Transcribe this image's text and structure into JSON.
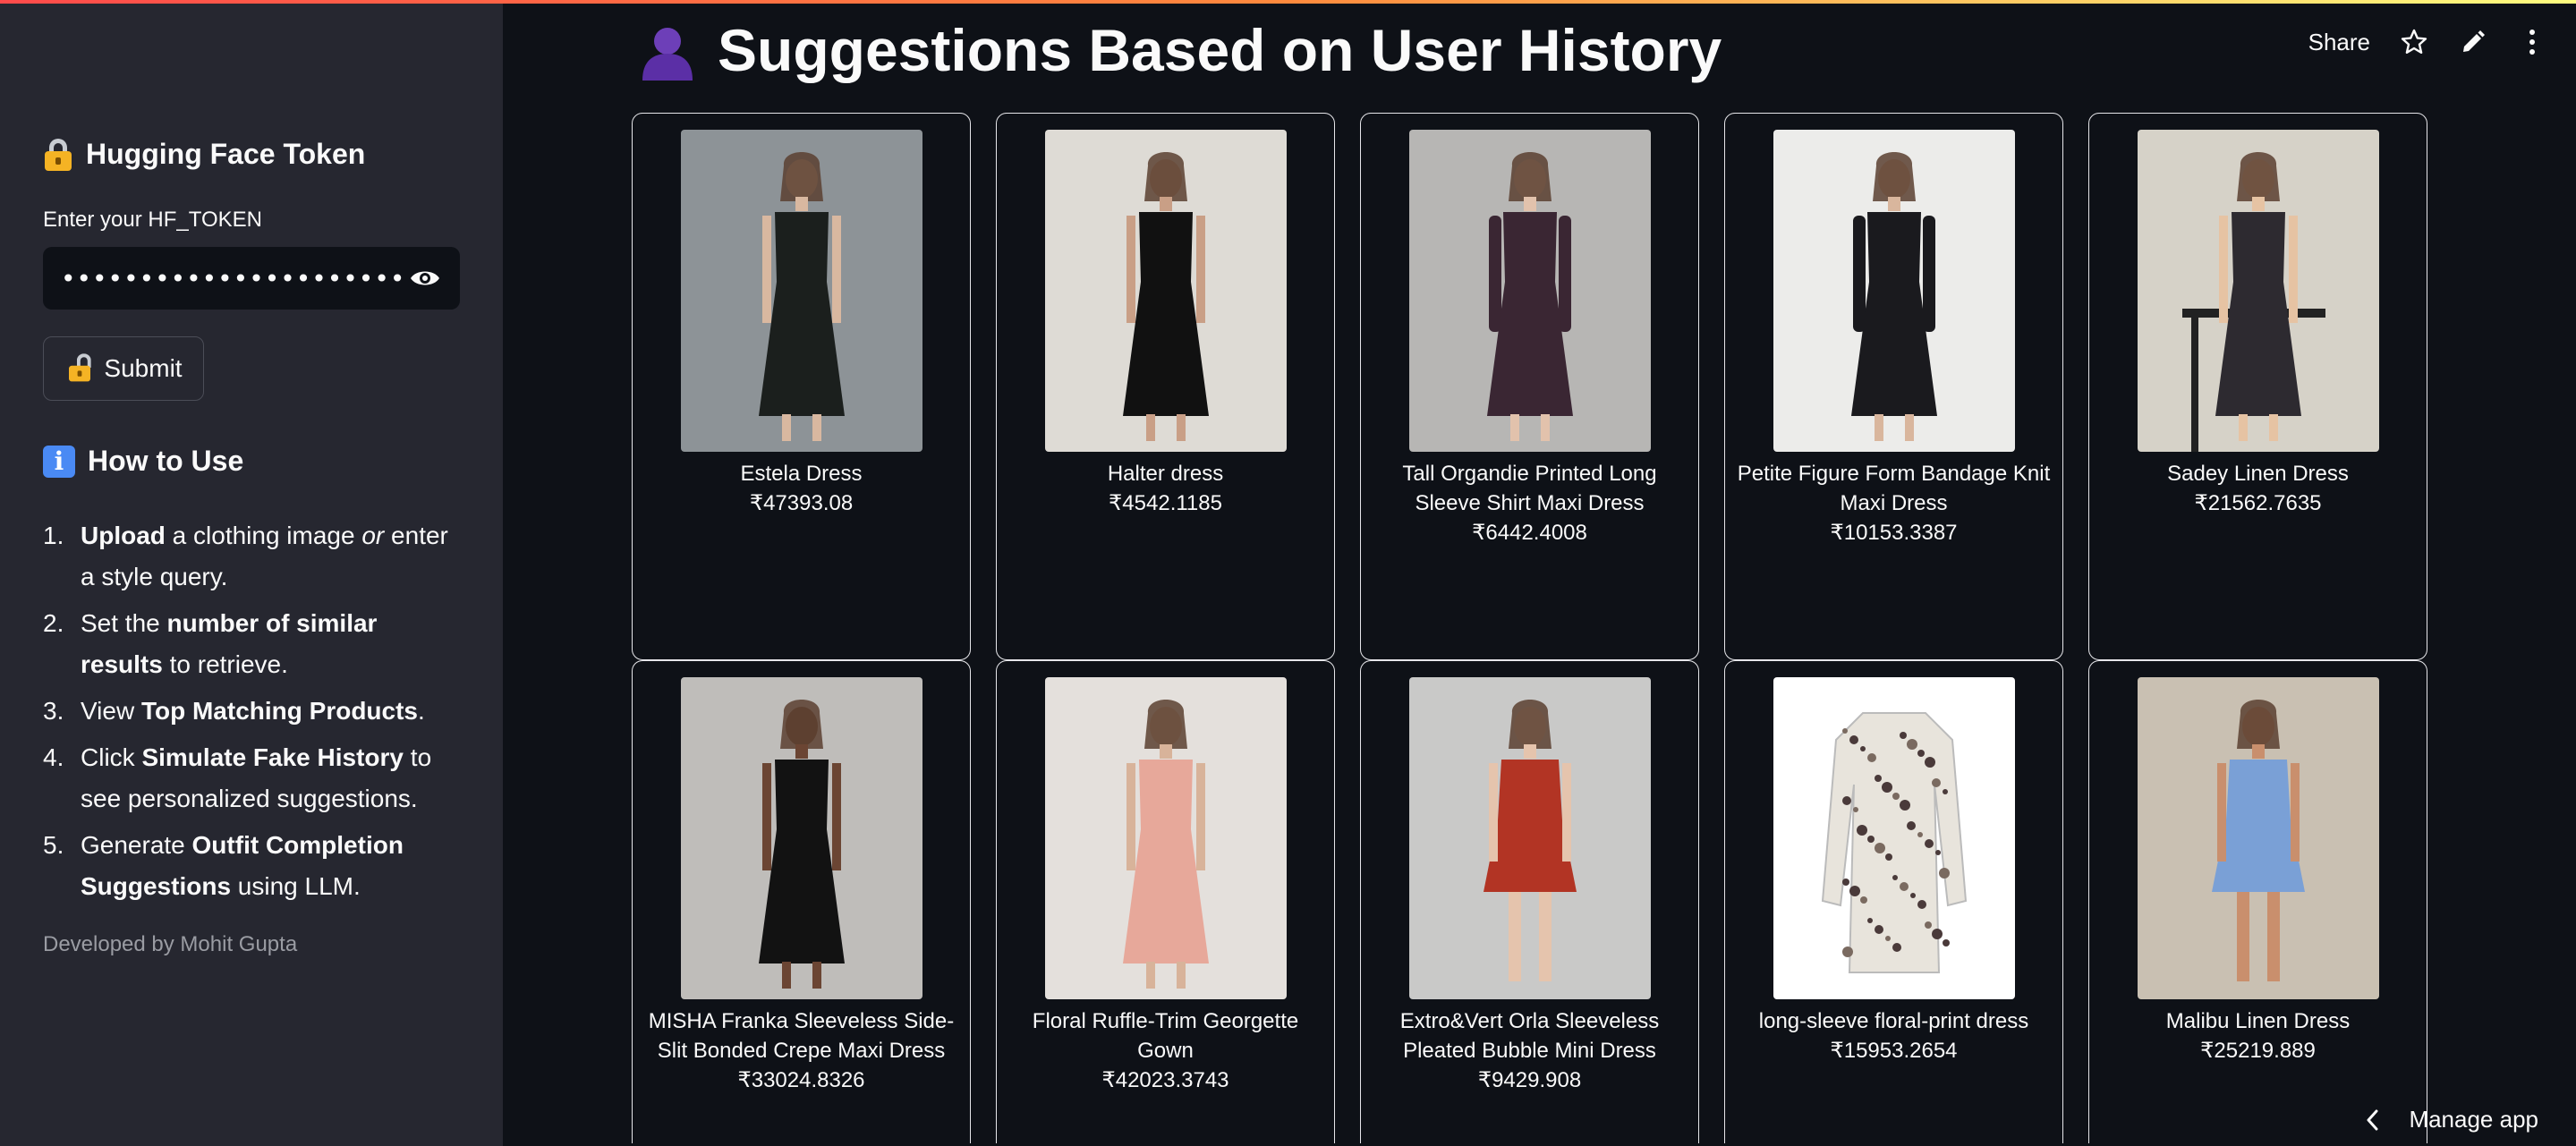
{
  "sidebar": {
    "token_heading": "Hugging Face Token",
    "token_label": "Enter your HF_TOKEN",
    "token_value": "••••••••••••••••••••••••••••••••••••••",
    "submit_label": "Submit",
    "howto_heading": "How to Use",
    "steps": [
      {
        "num": "1.",
        "parts": [
          {
            "b": "Upload"
          },
          {
            "t": " a clothing image "
          },
          {
            "i": "or"
          },
          {
            "t": " enter a style query."
          }
        ]
      },
      {
        "num": "2.",
        "parts": [
          {
            "t": "Set the "
          },
          {
            "b": "number of similar results"
          },
          {
            "t": " to retrieve."
          }
        ]
      },
      {
        "num": "3.",
        "parts": [
          {
            "t": "View "
          },
          {
            "b": "Top Matching Products"
          },
          {
            "t": "."
          }
        ]
      },
      {
        "num": "4.",
        "parts": [
          {
            "t": "Click "
          },
          {
            "b": "Simulate Fake History"
          },
          {
            "t": " to see personalized suggestions."
          }
        ]
      },
      {
        "num": "5.",
        "parts": [
          {
            "t": "Generate "
          },
          {
            "b": "Outfit Completion Suggestions"
          },
          {
            "t": " using LLM."
          }
        ]
      }
    ],
    "credit": "Developed by Mohit Gupta"
  },
  "header": {
    "title": "Suggestions Based on User History",
    "share_label": "Share"
  },
  "products": [
    {
      "name": "Estela Dress",
      "price": "₹47393.08",
      "bg": "#8d9397",
      "dress": "#1b1f1d",
      "skin": "#d9b8a0",
      "style": "gown"
    },
    {
      "name": "Halter dress",
      "price": "₹4542.1185",
      "bg": "#dedbd5",
      "dress": "#111111",
      "skin": "#c99f86",
      "style": "halter"
    },
    {
      "name": "Tall Organdie Printed Long Sleeve Shirt Maxi Dress",
      "price": "₹6442.4008",
      "bg": "#b7b6b4",
      "dress": "#3a2633",
      "skin": "#e2c2ac",
      "style": "longsleeve"
    },
    {
      "name": "Petite Figure Form Bandage Knit Maxi Dress",
      "price": "₹10153.3387",
      "bg": "#ececea",
      "dress": "#1a1a1e",
      "skin": "#d9b69d",
      "style": "longsleeve"
    },
    {
      "name": "Sadey Linen Dress",
      "price": "₹21562.7635",
      "bg": "#d6d2c8",
      "dress": "#2d2a30",
      "skin": "#e6c3a3",
      "style": "seated"
    },
    {
      "name": "MISHA Franka Sleeveless Side-Slit Bonded Crepe Maxi Dress",
      "price": "₹33024.8326",
      "bg": "#bfbdba",
      "dress": "#121212",
      "skin": "#6b4533",
      "style": "halter"
    },
    {
      "name": "Floral Ruffle-Trim Georgette Gown",
      "price": "₹42023.3743",
      "bg": "#e4e0dc",
      "dress": "#e7a89a",
      "skin": "#d8b39a",
      "style": "gown"
    },
    {
      "name": "Extro&Vert Orla Sleeveless Pleated Bubble Mini Dress",
      "price": "₹9429.908",
      "bg": "#c9c9c8",
      "dress": "#b23424",
      "skin": "#e5c4ad",
      "style": "mini"
    },
    {
      "name": "long-sleeve floral-print dress",
      "price": "₹15953.2654",
      "bg": "#ffffff",
      "dress": "#e8e4dc",
      "skin": "#ffffff",
      "style": "flat"
    },
    {
      "name": "Malibu Linen Dress",
      "price": "₹25219.889",
      "bg": "#c9c0b2",
      "dress": "#7aa0d6",
      "skin": "#c98f6d",
      "style": "mini"
    }
  ],
  "footer": {
    "manage_label": "Manage app"
  }
}
